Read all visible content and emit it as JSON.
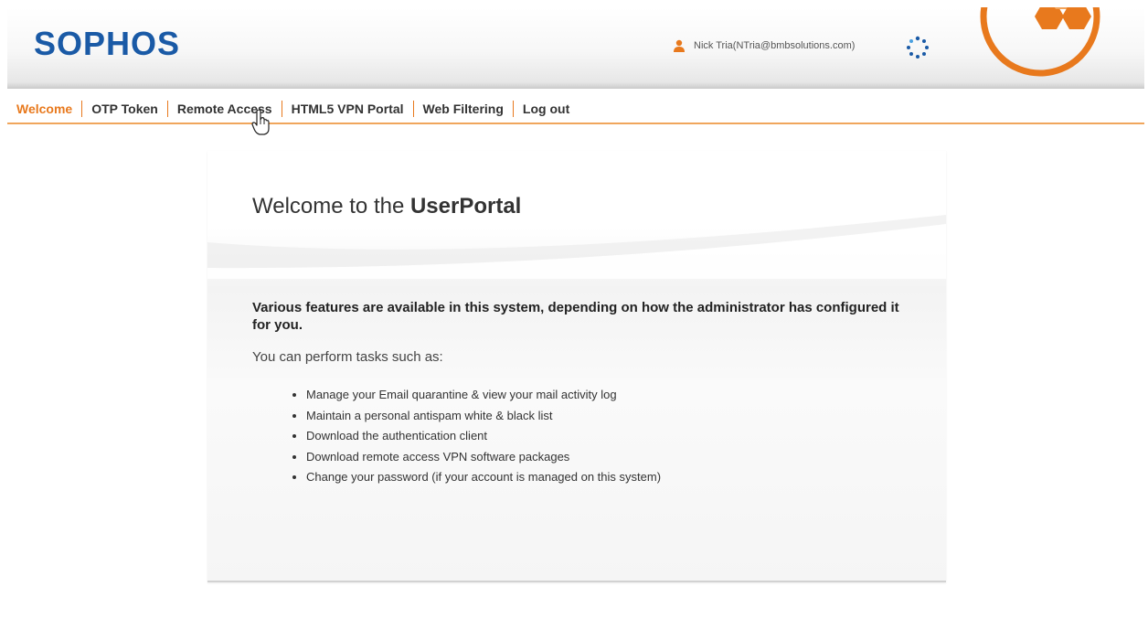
{
  "header": {
    "logo_text": "SOPHOS",
    "brand_color": "#1a5aa6",
    "accent_color": "#e8791d",
    "user_label": "Nick Tria(NTria@bmbsolutions.com)",
    "user_icon": "user-icon",
    "activity_icon": "loading-spinner-icon"
  },
  "nav": {
    "items": [
      {
        "label": "Welcome",
        "active": true
      },
      {
        "label": "OTP Token",
        "active": false
      },
      {
        "label": "Remote Access",
        "active": false
      },
      {
        "label": "HTML5 VPN Portal",
        "active": false
      },
      {
        "label": "Web Filtering",
        "active": false
      },
      {
        "label": "Log out",
        "active": false
      }
    ]
  },
  "main": {
    "title_prefix": "Welcome to the ",
    "title_bold": "UserPortal",
    "intro": "Various features are available in this system, depending on how the administrator has configured it for you.",
    "tasks_heading": "You can perform tasks such as:",
    "tasks": [
      "Manage your Email quarantine & view your mail activity log",
      "Maintain a personal antispam white & black list",
      "Download the authentication client",
      "Download remote access VPN software packages",
      "Change your password (if your account is managed on this system)"
    ]
  }
}
